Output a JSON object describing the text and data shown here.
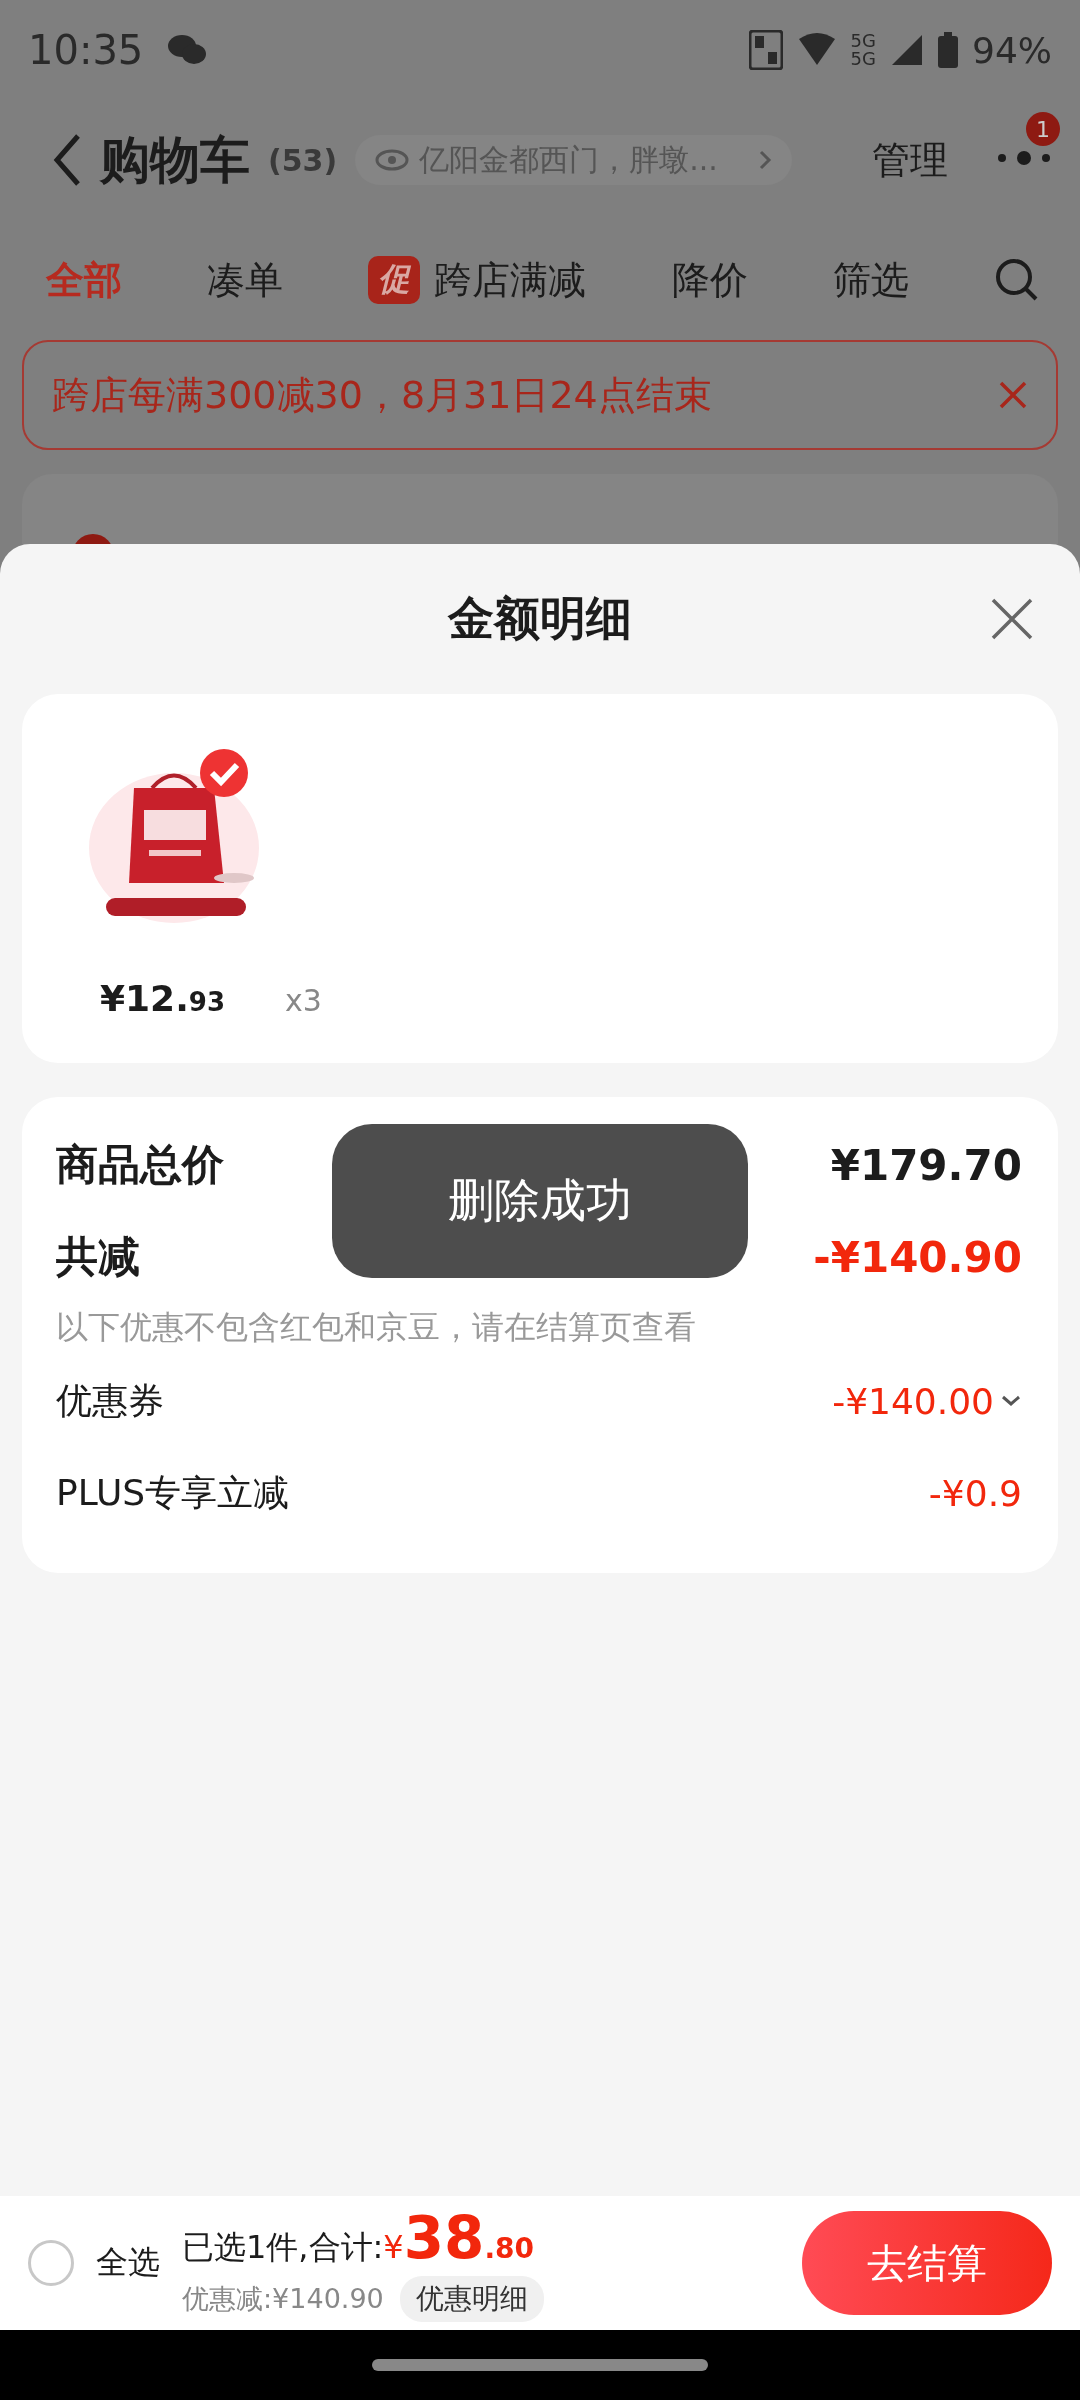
{
  "status_bar": {
    "time": "10:35",
    "battery": "94%",
    "network": [
      "5G",
      "5G"
    ]
  },
  "header": {
    "title": "购物车",
    "count": "(53)",
    "address": "亿阳金都西门，胖墩...",
    "manage": "管理",
    "badge": "1"
  },
  "tabs": [
    {
      "label": "全部",
      "selected": true,
      "kind": "text"
    },
    {
      "label": "凑单",
      "selected": false,
      "kind": "text"
    },
    {
      "label": "跨店满减",
      "selected": false,
      "kind": "promo",
      "tag": "促"
    },
    {
      "label": "降价",
      "selected": false,
      "kind": "text"
    },
    {
      "label": "筛选",
      "selected": false,
      "kind": "text"
    }
  ],
  "banner": {
    "text": "跨店每满300减30，8月31日24点结束"
  },
  "sheet": {
    "title": "金额明细",
    "product": {
      "kind": "picture",
      "price_main": "¥12.",
      "price_cents": "93",
      "quantity": "x3"
    },
    "summary": {
      "rows": [
        {
          "kind": "total",
          "label": "商品总价",
          "value": "¥179.70"
        },
        {
          "kind": "discount_total",
          "label": "共减",
          "value": "-¥140.90"
        },
        {
          "kind": "note",
          "label": "以下优惠不包含红包和京豆，请在结算页查看"
        },
        {
          "kind": "item",
          "label": "优惠券",
          "value": "-¥140.00",
          "expandable": true
        },
        {
          "kind": "item",
          "label": "PLUS专享立减",
          "value": "-¥0.9",
          "expandable": false
        }
      ]
    },
    "toast": "删除成功"
  },
  "footer": {
    "select_all": {
      "label": "全选",
      "checked": false
    },
    "summary": "已选1件,合计:",
    "currency": "¥",
    "total_main": "38",
    "total_cents": ".80",
    "discount": "优惠减:¥140.90",
    "detail_button": "优惠明细",
    "checkout": "去结算"
  }
}
